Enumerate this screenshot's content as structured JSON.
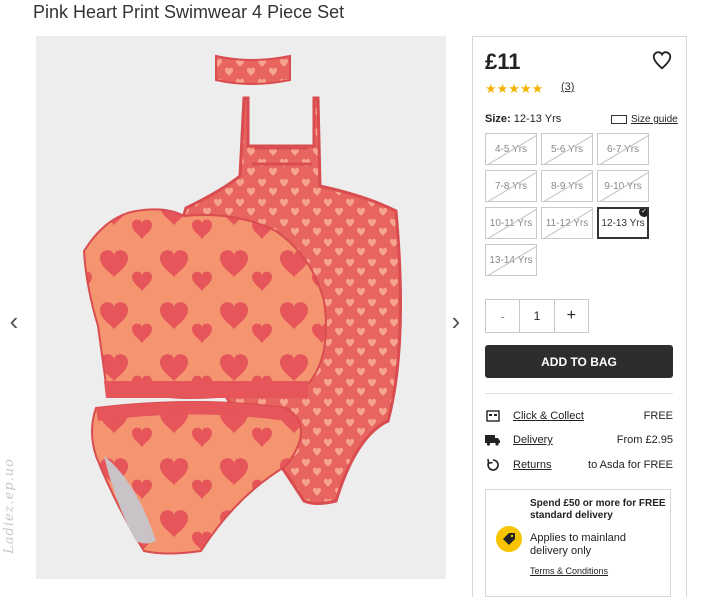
{
  "product": {
    "title": "Pink Heart Print Swimwear 4 Piece Set",
    "price": "£11",
    "rating_stars": "★★★★★",
    "rating_value": 5,
    "review_count": "(3)"
  },
  "watermark": "Ladiez.ep.uo",
  "size": {
    "label": "Size:",
    "selected": "12-13 Yrs",
    "guide_label": "Size guide",
    "options": [
      {
        "label": "4-5 Yrs",
        "available": false
      },
      {
        "label": "5-6 Yrs",
        "available": false
      },
      {
        "label": "6-7 Yrs",
        "available": false
      },
      {
        "label": "7-8 Yrs",
        "available": false
      },
      {
        "label": "8-9 Yrs",
        "available": false
      },
      {
        "label": "9-10 Yrs",
        "available": false
      },
      {
        "label": "10-11 Yrs",
        "available": false
      },
      {
        "label": "11-12 Yrs",
        "available": false
      },
      {
        "label": "12-13 Yrs",
        "available": true,
        "selected": true
      },
      {
        "label": "13-14 Yrs",
        "available": false
      }
    ]
  },
  "quantity": {
    "minus": "-",
    "value": "1",
    "plus": "+"
  },
  "cart": {
    "add_label": "ADD TO BAG"
  },
  "services": [
    {
      "icon": "store-icon",
      "label": "Click & Collect",
      "value": "FREE"
    },
    {
      "icon": "truck-icon",
      "label": "Delivery",
      "value": "From £2.95"
    },
    {
      "icon": "return-icon",
      "label": "Returns",
      "value": "to Asda for FREE"
    }
  ],
  "promo": {
    "headline": "Spend £50 or more for FREE standard delivery",
    "text": "Applies to mainland delivery only",
    "terms": "Terms & Conditions",
    "icon": "tag-icon"
  },
  "colors": {
    "swimsuit_base": "#e8645f",
    "heart_print": "#f7a48e",
    "button_dark": "#2d2d2d",
    "star": "#f5b400",
    "promo_icon": "#f9c300"
  }
}
